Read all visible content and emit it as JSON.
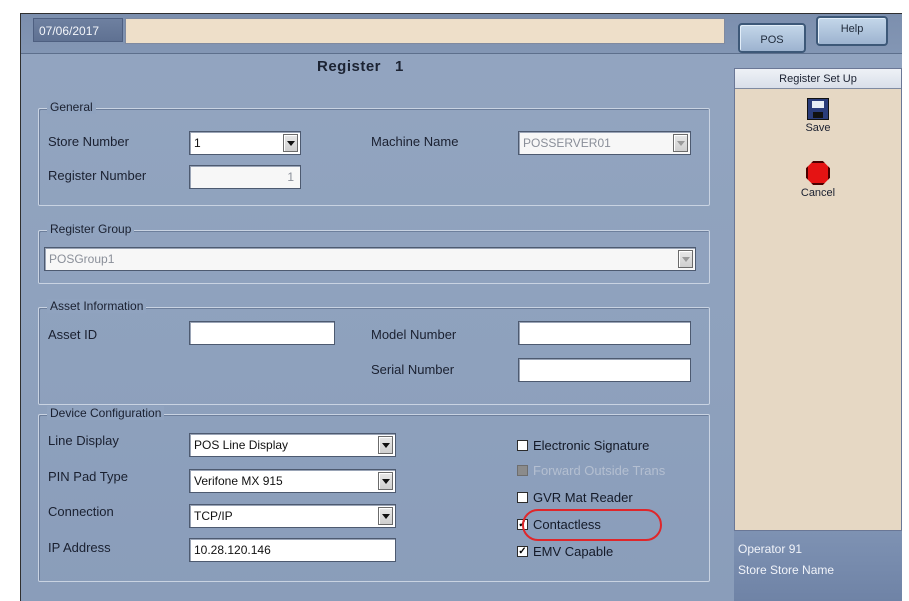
{
  "topbar": {
    "date": "07/06/2017",
    "message": "",
    "pos_button": "POS",
    "help_button": "Help"
  },
  "form": {
    "title": "Register",
    "register_no": "1",
    "general": {
      "legend": "General",
      "store_number_label": "Store Number",
      "store_number_value": "1",
      "machine_name_label": "Machine Name",
      "machine_name_value": "POSSERVER01",
      "register_number_label": "Register Number",
      "register_number_value": "1"
    },
    "register_group": {
      "legend": "Register Group",
      "value": "POSGroup1"
    },
    "asset": {
      "legend": "Asset Information",
      "asset_id_label": "Asset ID",
      "asset_id_value": "",
      "model_number_label": "Model Number",
      "model_number_value": "",
      "serial_number_label": "Serial Number",
      "serial_number_value": ""
    },
    "device": {
      "legend": "Device Configuration",
      "line_display_label": "Line Display",
      "line_display_value": "POS Line Display",
      "pin_pad_label": "PIN Pad Type",
      "pin_pad_value": "Verifone MX 915",
      "connection_label": "Connection",
      "connection_value": "TCP/IP",
      "ip_label": "IP Address",
      "ip_value": "10.28.120.146",
      "checkboxes": [
        {
          "label": "Electronic Signature",
          "checked": false,
          "mark": "",
          "enabled": true
        },
        {
          "label": "Forward Outside Trans",
          "checked": false,
          "mark": "",
          "enabled": false
        },
        {
          "label": "GVR Mat Reader",
          "checked": false,
          "mark": "",
          "enabled": true
        },
        {
          "label": "Contactless",
          "checked": true,
          "mark": "✓",
          "enabled": true
        },
        {
          "label": "EMV Capable",
          "checked": true,
          "mark": "✓",
          "enabled": true
        }
      ]
    }
  },
  "side_panel": {
    "header": "Register Set Up",
    "save_label": "Save",
    "cancel_label": "Cancel",
    "operator": "Operator 91",
    "store": "Store Store Name"
  },
  "colors": {
    "background": "#8ea1bd",
    "highlight": "#e0262a",
    "panel": "#e6d8c4"
  },
  "icons": [
    "save-icon",
    "cancel-icon",
    "chevron-down-icon"
  ]
}
